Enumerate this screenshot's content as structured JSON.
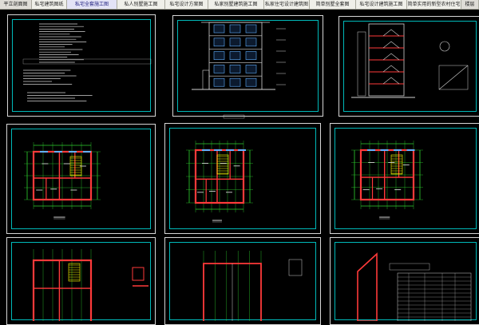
{
  "tabs": [
    {
      "label": "平立剖面图",
      "state": "cut"
    },
    {
      "label": "私宅建筑图纸",
      "state": "normal"
    },
    {
      "label": "私宅全套施工图",
      "state": "active"
    },
    {
      "label": "私人别墅施工图",
      "state": "normal"
    },
    {
      "label": "私宅设计方案图",
      "state": "normal"
    },
    {
      "label": "私家别墅建筑施工图",
      "state": "normal"
    },
    {
      "label": "私家住宅设计建筑图",
      "state": "normal"
    },
    {
      "label": "简单别墅全套图",
      "state": "normal"
    },
    {
      "label": "私宅设计建筑施工图",
      "state": "normal"
    },
    {
      "label": "简单实用的新型农村住宅",
      "state": "normal"
    },
    {
      "label": "楼层",
      "state": "cut"
    }
  ],
  "colors": {
    "background": "#000000",
    "sheet_border": "#d6d6d6",
    "sheet_inner": "#00b9b9",
    "wall": "#ff3a3a",
    "dimension": "#2fd22f",
    "text": "#d2d2d2",
    "stair": "#ffff00"
  },
  "sheets": [
    {
      "id": "design-notes",
      "kind": "notes"
    },
    {
      "id": "front-elevation",
      "kind": "elevation"
    },
    {
      "id": "section",
      "kind": "section"
    },
    {
      "id": "plan-1",
      "kind": "plan"
    },
    {
      "id": "plan-2",
      "kind": "plan"
    },
    {
      "id": "plan-3",
      "kind": "plan"
    },
    {
      "id": "plan-4",
      "kind": "plan"
    },
    {
      "id": "roof-plan",
      "kind": "plan"
    },
    {
      "id": "detail-table",
      "kind": "table"
    }
  ]
}
